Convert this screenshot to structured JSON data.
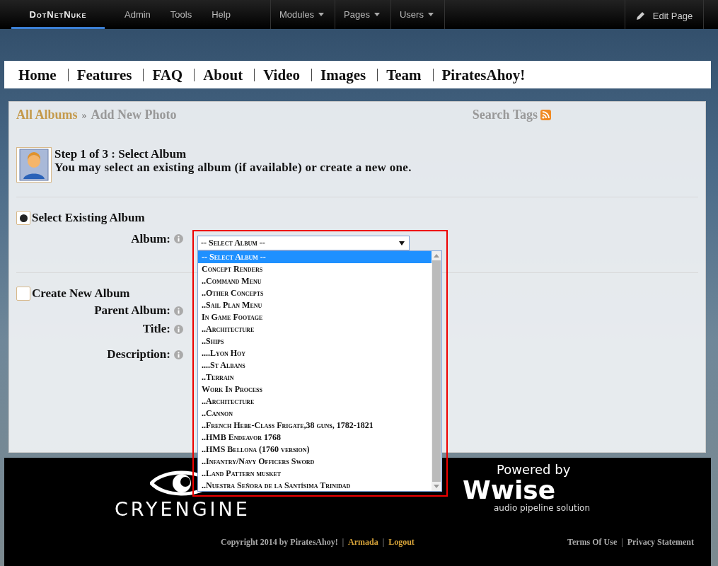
{
  "admin_bar": {
    "logo": "DotNetNuke",
    "menu": [
      {
        "label": "Admin",
        "selected": false
      },
      {
        "label": "Tools",
        "selected": false
      },
      {
        "label": "Help",
        "selected": false
      }
    ],
    "dropdown_menus": [
      "Modules",
      "Pages",
      "Users"
    ],
    "edit_page": "Edit Page"
  },
  "site_nav": [
    "Home",
    "Features",
    "FAQ",
    "About",
    "Video",
    "Images",
    "Team",
    "PiratesAhoy!"
  ],
  "breadcrumb": {
    "root": "All Albums",
    "separator": "»",
    "current": "Add New Photo"
  },
  "search_tags": "Search Tags",
  "step": {
    "title": "Step 1 of 3 : Select Album",
    "description": "You may select an existing album (if available) or create a new one."
  },
  "select_existing": {
    "label": "Select Existing Album",
    "selected": true,
    "album_label": "Album:",
    "dropdown": {
      "value": "-- Select Album --",
      "expanded": true,
      "options": [
        {
          "label": "-- Select Album --",
          "selected": true
        },
        {
          "label": "Concept Renders",
          "selected": false
        },
        {
          "label": "..Command Menu",
          "selected": false
        },
        {
          "label": "..Other Concepts",
          "selected": false
        },
        {
          "label": "..Sail Plan Menu",
          "selected": false
        },
        {
          "label": "In Game Footage",
          "selected": false
        },
        {
          "label": "..Architecture",
          "selected": false
        },
        {
          "label": "..Ships",
          "selected": false
        },
        {
          "label": "....Lyon Hoy",
          "selected": false
        },
        {
          "label": "....St Albans",
          "selected": false
        },
        {
          "label": "..Terrain",
          "selected": false
        },
        {
          "label": "Work In Process",
          "selected": false
        },
        {
          "label": "..Architecture",
          "selected": false
        },
        {
          "label": "..Cannon",
          "selected": false
        },
        {
          "label": "..French Hebe-Class Frigate,38 guns, 1782-1821",
          "selected": false
        },
        {
          "label": "..HMB Endeavor 1768",
          "selected": false
        },
        {
          "label": "..HMS Bellona (1760 version)",
          "selected": false
        },
        {
          "label": "..Infantry/Navy Officers Sword",
          "selected": false
        },
        {
          "label": "..Land Pattern musket",
          "selected": false
        },
        {
          "label": "..Nuestra Señora de la Santísima Trinidad",
          "selected": false
        }
      ]
    }
  },
  "create_new": {
    "label": "Create New Album",
    "selected": false,
    "fields": [
      "Parent Album:",
      "Title:",
      "Description:"
    ]
  },
  "footer": {
    "engine_logo": "CRYENGINE",
    "powered_by": "Powered by",
    "audio_logo": "Wwise",
    "audio_tagline": "audio pipeline solution",
    "left": [
      {
        "kind": "text",
        "text": "Copyright 2014 by PiratesAhoy!"
      },
      {
        "kind": "separator",
        "text": "|"
      },
      {
        "kind": "link",
        "text": "Armada"
      },
      {
        "kind": "separator",
        "text": "|"
      },
      {
        "kind": "link",
        "text": "Logout"
      }
    ],
    "right": [
      {
        "kind": "link",
        "text": "Terms Of Use"
      },
      {
        "kind": "separator",
        "text": "|"
      },
      {
        "kind": "link",
        "text": "Privacy Statement"
      }
    ]
  }
}
